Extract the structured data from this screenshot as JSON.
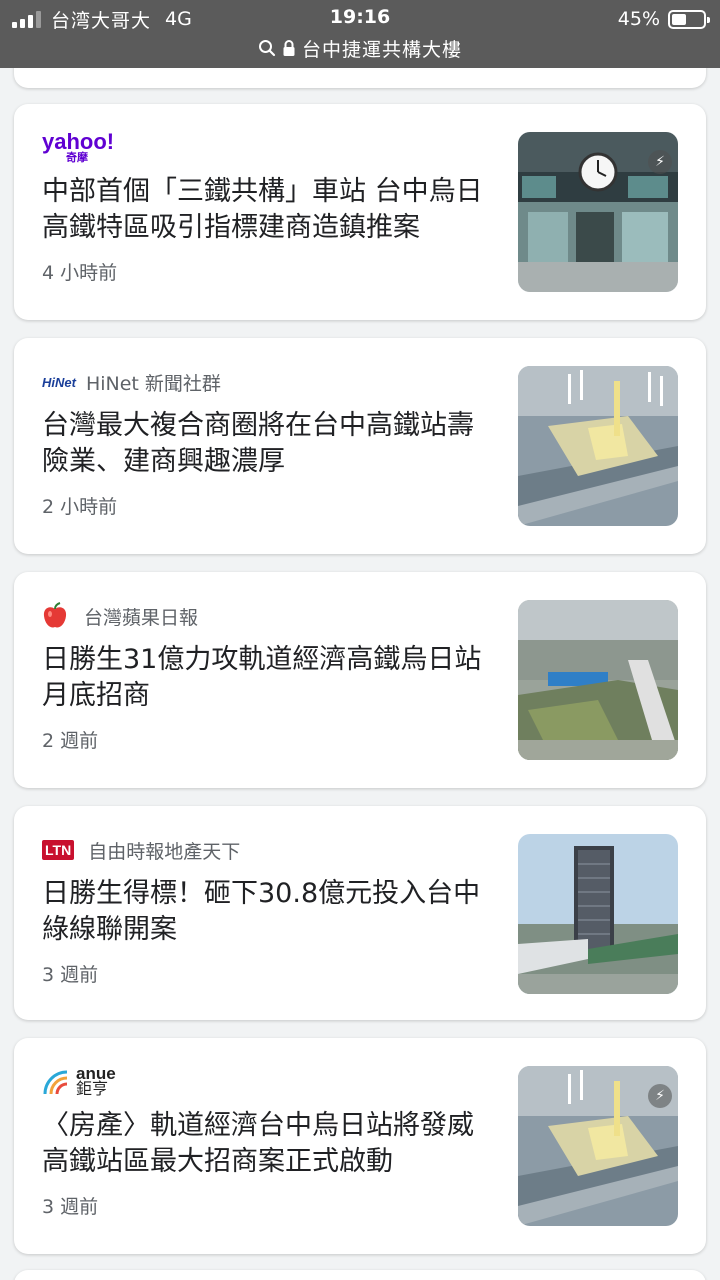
{
  "status_bar": {
    "carrier": "台湾大哥大",
    "network": "4G",
    "time": "19:16",
    "battery_percent": "45%",
    "battery_level": 0.45,
    "url_title": "台中捷運共構大樓"
  },
  "articles": [
    {
      "source_logo": "yahoo!",
      "source_logo_sub": "奇摩",
      "source_name": "",
      "headline": "中部首個「三鐵共構」車站 台中烏日高鐵特區吸引指標建商造鎮推案",
      "time": "4 小時前",
      "thumbnail_icon": "station-clock-photo",
      "accent": "#6001d2"
    },
    {
      "source_logo": "HiNet",
      "source_name": "HiNet 新聞社群",
      "headline": "台灣最大複合商圈將在台中高鐵站壽險業、建商興趣濃厚",
      "time": "2 小時前",
      "thumbnail_icon": "aerial-rendering-photo"
    },
    {
      "source_logo": "apple-icon",
      "source_name": "台灣蘋果日報",
      "headline": "日勝生31億力攻軌道經濟高鐵烏日站月底招商",
      "time": "2 週前",
      "thumbnail_icon": "aerial-city-photo",
      "accent": "#e53935"
    },
    {
      "source_logo": "LTN",
      "source_name": "自由時報地產天下",
      "headline": "日勝生得標！砸下30.8億元投入台中綠線聯開案",
      "time": "3 週前",
      "thumbnail_icon": "tower-rendering-photo",
      "accent": "#c8102e"
    },
    {
      "source_logo": "anue",
      "source_logo_sub": "鉅亨",
      "source_name": "",
      "headline": "〈房產〉軌道經濟台中烏日站將發威高鐵站區最大招商案正式啟動",
      "time": "3 週前",
      "thumbnail_icon": "aerial-rendering-photo"
    }
  ]
}
